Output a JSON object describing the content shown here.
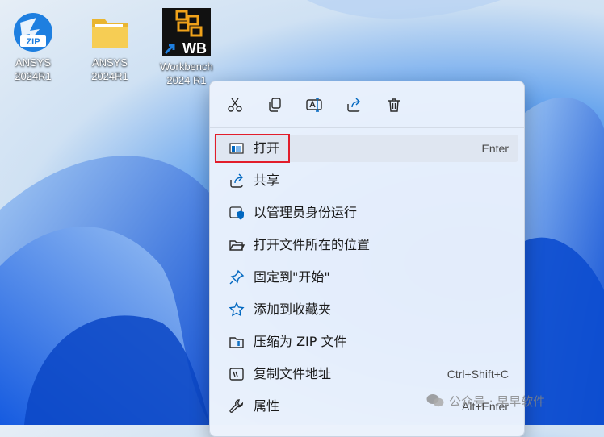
{
  "desktop": {
    "icons": [
      {
        "name": "ANSYS\n2024R1",
        "kind": "zip-archive-icon",
        "badge": "ZIP"
      },
      {
        "name": "ANSYS\n2024R1",
        "kind": "folder-icon"
      },
      {
        "name": "Workbench\n2024 R1",
        "kind": "workbench-shortcut-icon",
        "badge": "WB"
      }
    ]
  },
  "context_menu": {
    "toolbar": [
      "cut-icon",
      "copy-icon",
      "rename-icon",
      "share-icon",
      "delete-icon"
    ],
    "items": [
      {
        "label": "打开",
        "shortcut": "Enter",
        "icon": "open-window-icon",
        "highlighted": true
      },
      {
        "label": "共享",
        "shortcut": "",
        "icon": "share-icon"
      },
      {
        "label": "以管理员身份运行",
        "shortcut": "",
        "icon": "admin-shield-icon"
      },
      {
        "label": "打开文件所在的位置",
        "shortcut": "",
        "icon": "folder-open-icon"
      },
      {
        "label": "固定到\"开始\"",
        "shortcut": "",
        "icon": "pin-icon"
      },
      {
        "label": "添加到收藏夹",
        "shortcut": "",
        "icon": "star-icon"
      },
      {
        "label": "压缩为 ZIP 文件",
        "shortcut": "",
        "icon": "zip-compress-icon"
      },
      {
        "label": "复制文件地址",
        "shortcut": "Ctrl+Shift+C",
        "icon": "copy-path-icon"
      },
      {
        "label": "属性",
        "shortcut": "Alt+Enter",
        "icon": "wrench-icon"
      }
    ]
  },
  "watermark": {
    "text": "公众号 · 早早软件"
  },
  "colors": {
    "accent": "#0067c0",
    "highlight_box": "#e21d2b",
    "menu_bg": "#ecf2fc"
  }
}
